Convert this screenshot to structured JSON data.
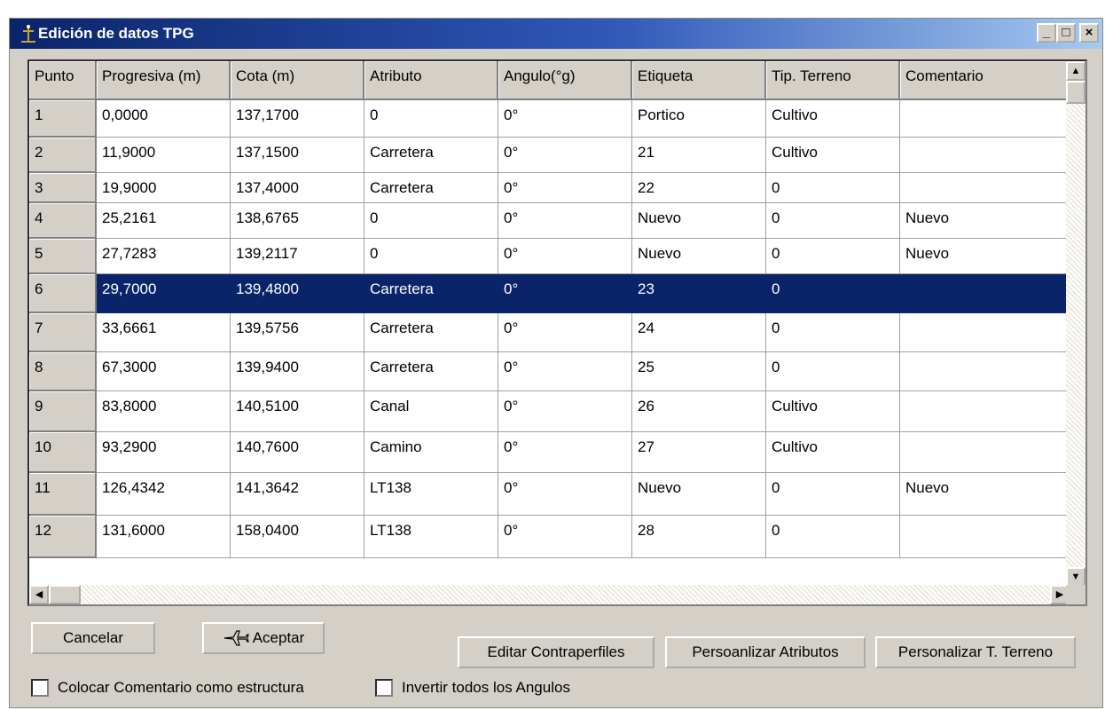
{
  "window": {
    "title": "Edición de datos TPG",
    "minimize": "_",
    "maximize": "□",
    "close": "×"
  },
  "grid": {
    "columns": [
      "Punto",
      "Progresiva (m)",
      "Cota (m)",
      "Atributo",
      "Angulo(°g)",
      "Etiqueta",
      "Tip. Terreno",
      "Comentario"
    ],
    "rows": [
      [
        "1",
        "0,0000",
        "137,1700",
        "0",
        "0°",
        "Portico",
        "Cultivo",
        ""
      ],
      [
        "2",
        "11,9000",
        "137,1500",
        "Carretera",
        "0°",
        "21",
        "Cultivo",
        ""
      ],
      [
        "3",
        "19,9000",
        "137,4000",
        "Carretera",
        "0°",
        "22",
        "0",
        ""
      ],
      [
        "4",
        "25,2161",
        "138,6765",
        "0",
        "0°",
        "Nuevo",
        "0",
        "Nuevo"
      ],
      [
        "5",
        "27,7283",
        "139,2117",
        "0",
        "0°",
        "Nuevo",
        "0",
        "Nuevo"
      ],
      [
        "6",
        "29,7000",
        "139,4800",
        "Carretera",
        "0°",
        "23",
        "0",
        ""
      ],
      [
        "7",
        "33,6661",
        "139,5756",
        "Carretera",
        "0°",
        "24",
        "0",
        ""
      ],
      [
        "8",
        "67,3000",
        "139,9400",
        "Carretera",
        "0°",
        "25",
        "0",
        ""
      ],
      [
        "9",
        "83,8000",
        "140,5100",
        "Canal",
        "0°",
        "26",
        "Cultivo",
        ""
      ],
      [
        "10",
        "93,2900",
        "140,7600",
        "Camino",
        "0°",
        "27",
        "Cultivo",
        ""
      ],
      [
        "11",
        "126,4342",
        "141,3642",
        "LT138",
        "0°",
        "Nuevo",
        "0",
        "Nuevo"
      ],
      [
        "12",
        "131,6000",
        "158,0400",
        "LT138",
        "0°",
        "28",
        "0",
        ""
      ]
    ],
    "selected_row": 6
  },
  "buttons": {
    "cancel": "Cancelar",
    "accept": "Aceptar",
    "edit_profiles": "Editar Contraperfiles",
    "custom_attributes": "Persoanlizar Atributos",
    "custom_terrain": "Personalizar T. Terreno"
  },
  "checkboxes": {
    "comment_structure": "Colocar Comentario como estructura",
    "invert_angles": "Invertir todos los Angulos"
  }
}
